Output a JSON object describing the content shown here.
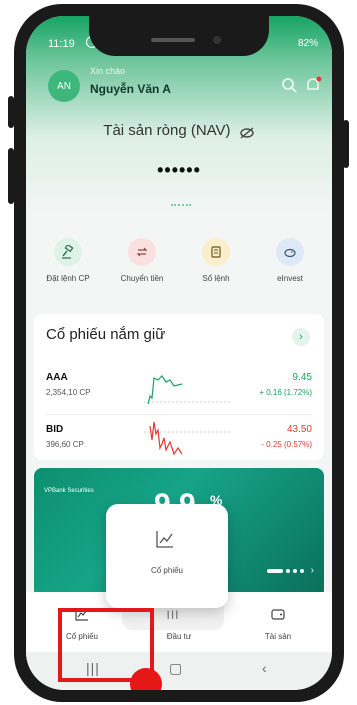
{
  "status_bar": {
    "time": "11:19",
    "battery": "82%"
  },
  "header": {
    "avatar_initials": "AN",
    "greeting": "Xin chào",
    "user_name": "Nguyễn Văn A"
  },
  "nav": {
    "title": "Tài sản ròng (NAV)",
    "masked_value": "••••••"
  },
  "actions": [
    {
      "label": "Đặt lệnh CP",
      "icon": "gavel-icon"
    },
    {
      "label": "Chuyển tiền",
      "icon": "transfer-icon"
    },
    {
      "label": "Sổ lệnh",
      "icon": "order-book-icon"
    },
    {
      "label": "eInvest",
      "icon": "piggy-bank-icon"
    }
  ],
  "holdings": {
    "title": "Cổ phiếu nắm giữ",
    "rows": [
      {
        "ticker": "AAA",
        "quantity": "2,354,10 CP",
        "price": "9.45",
        "change": "+ 0.16 (1.72%)",
        "trend": "up"
      },
      {
        "ticker": "BID",
        "quantity": "396,60 CP",
        "price": "43.50",
        "change": "- 0.25 (0.57%)",
        "trend": "down"
      }
    ]
  },
  "banner": {
    "brand": "VPBank Securities",
    "headline": "9.9",
    "percent": "%"
  },
  "tabs": [
    {
      "label": "Cổ phiếu",
      "icon": "chart-line-icon"
    },
    {
      "label": "Đầu tư",
      "icon": "invest-icon"
    },
    {
      "label": "Tài sản",
      "icon": "wallet-icon"
    }
  ],
  "popup": {
    "label": "Cổ phiếu",
    "bar_text": "III"
  },
  "colors": {
    "brand_green": "#15a463",
    "up": "#15a463",
    "down": "#e53935",
    "highlight": "#e51717"
  }
}
